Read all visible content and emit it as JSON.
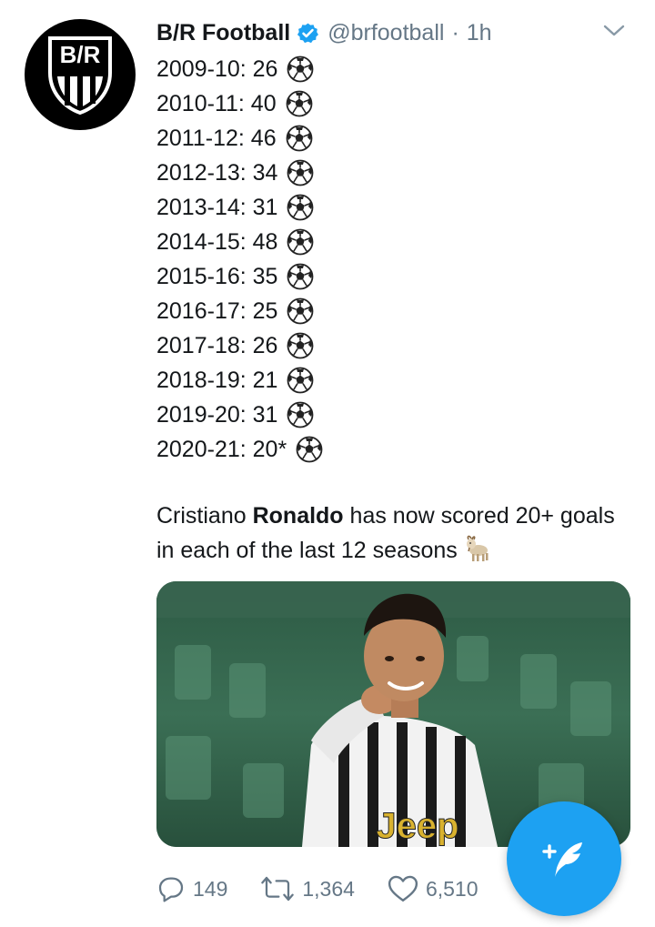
{
  "account": {
    "name": "B/R Football",
    "handle": "@brfootball",
    "separator": "·",
    "time": "1h",
    "avatar_text": "B/R"
  },
  "seasons": [
    {
      "label": "2009-10: 26"
    },
    {
      "label": "2010-11: 40"
    },
    {
      "label": "2011-12: 46"
    },
    {
      "label": "2012-13: 34"
    },
    {
      "label": "2013-14: 31"
    },
    {
      "label": "2014-15: 48"
    },
    {
      "label": "2015-16: 35"
    },
    {
      "label": "2016-17: 25"
    },
    {
      "label": "2017-18: 26"
    },
    {
      "label": "2018-19: 21"
    },
    {
      "label": "2019-20: 31"
    },
    {
      "label": "2020-21: 20*"
    }
  ],
  "body": {
    "prefix": "Cristiano ",
    "bold": "Ronaldo",
    "suffix": " has now scored 20+ goals in each of the last 12 seasons"
  },
  "media": {
    "shirt_text": "Jeep"
  },
  "actions": {
    "replies": "149",
    "retweets": "1,364",
    "likes": "6,510"
  },
  "colors": {
    "accent": "#1da1f2",
    "muted": "#657786",
    "text": "#14171a"
  },
  "icons": {
    "verified": "verified-badge-icon",
    "chevron": "chevron-down-icon",
    "ball": "soccer-ball-icon",
    "goat": "goat-emoji-icon",
    "reply": "reply-icon",
    "retweet": "retweet-icon",
    "like": "heart-icon",
    "compose": "compose-tweet-icon"
  }
}
